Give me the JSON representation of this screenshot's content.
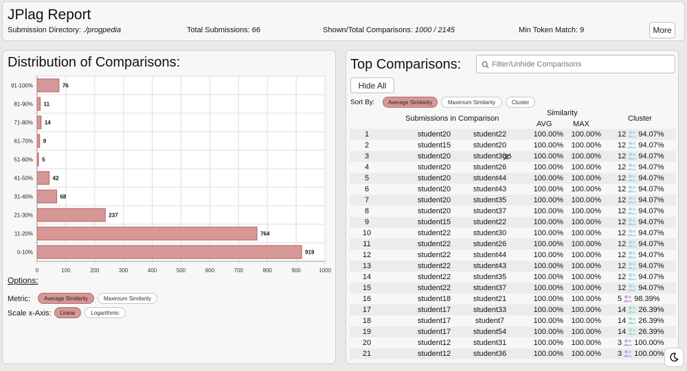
{
  "header": {
    "title": "JPlag Report",
    "dir_label": "Submission Directory:",
    "dir_value": "./progpedia",
    "total_label": "Total Submissions:",
    "total_value": "66",
    "shown_label": "Shown/Total Comparisons:",
    "shown_value": "1000 / 2145",
    "min_label": "Min Token Match:",
    "min_value": "9",
    "more_button": "More"
  },
  "distribution": {
    "title": "Distribution of Comparisons:",
    "options_title": "Options:",
    "metric_label": "Metric:",
    "metric_options": [
      "Average Similarity",
      "Maximum Similarity"
    ],
    "metric_selected": "Average Similarity",
    "scale_label": "Scale x-Axis:",
    "scale_options": [
      "Linear",
      "Logarithmic"
    ],
    "scale_selected": "Linear"
  },
  "chart_data": {
    "type": "bar",
    "orientation": "horizontal",
    "categories": [
      "91-100%",
      "81-90%",
      "71-80%",
      "61-70%",
      "51-60%",
      "41-50%",
      "31-40%",
      "21-30%",
      "11-20%",
      "0-10%"
    ],
    "values": [
      76,
      11,
      14,
      9,
      5,
      42,
      68,
      237,
      764,
      919
    ],
    "xlim": [
      0,
      1000
    ],
    "xticks": [
      0,
      100,
      200,
      300,
      400,
      500,
      600,
      700,
      800,
      900,
      1000
    ],
    "grid": true,
    "bar_color": "#d69797",
    "bar_border": "#b06666"
  },
  "top": {
    "title": "Top Comparisons:",
    "search_placeholder": "Filter/Unhide Comparisons",
    "hide_all": "Hide All",
    "sort_label": "Sort By:",
    "sort_options": [
      "Average Similarity",
      "Maximum Similarity",
      "Cluster"
    ],
    "sort_selected": "Average Similarity",
    "col_submissions": "Submissions in Comparison",
    "col_similarity": "Similarity",
    "col_avg": "AVG",
    "col_max": "MAX",
    "col_cluster": "Cluster",
    "rows": [
      {
        "n": "1",
        "a": "student20",
        "b": "student22",
        "avg": "100.00%",
        "max": "100.00%",
        "csize": "12",
        "cval": "94.07%",
        "ccolor": "#a8d8ea",
        "hidden": false
      },
      {
        "n": "2",
        "a": "student15",
        "b": "student20",
        "avg": "100.00%",
        "max": "100.00%",
        "csize": "12",
        "cval": "94.07%",
        "ccolor": "#a8d8ea",
        "hidden": false
      },
      {
        "n": "3",
        "a": "student20",
        "b": "student30",
        "avg": "100.00%",
        "max": "100.00%",
        "csize": "12",
        "cval": "94.07%",
        "ccolor": "#a8d8ea",
        "hidden": true
      },
      {
        "n": "4",
        "a": "student20",
        "b": "student26",
        "avg": "100.00%",
        "max": "100.00%",
        "csize": "12",
        "cval": "94.07%",
        "ccolor": "#a8d8ea",
        "hidden": false
      },
      {
        "n": "5",
        "a": "student20",
        "b": "student44",
        "avg": "100.00%",
        "max": "100.00%",
        "csize": "12",
        "cval": "94.07%",
        "ccolor": "#a8d8ea",
        "hidden": false
      },
      {
        "n": "6",
        "a": "student20",
        "b": "student43",
        "avg": "100.00%",
        "max": "100.00%",
        "csize": "12",
        "cval": "94.07%",
        "ccolor": "#a8d8ea",
        "hidden": false
      },
      {
        "n": "7",
        "a": "student20",
        "b": "student35",
        "avg": "100.00%",
        "max": "100.00%",
        "csize": "12",
        "cval": "94.07%",
        "ccolor": "#a8d8ea",
        "hidden": false
      },
      {
        "n": "8",
        "a": "student20",
        "b": "student37",
        "avg": "100.00%",
        "max": "100.00%",
        "csize": "12",
        "cval": "94.07%",
        "ccolor": "#a8d8ea",
        "hidden": false
      },
      {
        "n": "9",
        "a": "student15",
        "b": "student22",
        "avg": "100.00%",
        "max": "100.00%",
        "csize": "12",
        "cval": "94.07%",
        "ccolor": "#a8d8ea",
        "hidden": false
      },
      {
        "n": "10",
        "a": "student22",
        "b": "student30",
        "avg": "100.00%",
        "max": "100.00%",
        "csize": "12",
        "cval": "94.07%",
        "ccolor": "#a8d8ea",
        "hidden": false
      },
      {
        "n": "11",
        "a": "student22",
        "b": "student26",
        "avg": "100.00%",
        "max": "100.00%",
        "csize": "12",
        "cval": "94.07%",
        "ccolor": "#a8d8ea",
        "hidden": false
      },
      {
        "n": "12",
        "a": "student22",
        "b": "student44",
        "avg": "100.00%",
        "max": "100.00%",
        "csize": "12",
        "cval": "94.07%",
        "ccolor": "#a8d8ea",
        "hidden": false
      },
      {
        "n": "13",
        "a": "student22",
        "b": "student43",
        "avg": "100.00%",
        "max": "100.00%",
        "csize": "12",
        "cval": "94.07%",
        "ccolor": "#a8d8ea",
        "hidden": false
      },
      {
        "n": "14",
        "a": "student22",
        "b": "student35",
        "avg": "100.00%",
        "max": "100.00%",
        "csize": "12",
        "cval": "94.07%",
        "ccolor": "#a8d8ea",
        "hidden": false
      },
      {
        "n": "15",
        "a": "student22",
        "b": "student37",
        "avg": "100.00%",
        "max": "100.00%",
        "csize": "12",
        "cval": "94.07%",
        "ccolor": "#a8d8ea",
        "hidden": false
      },
      {
        "n": "16",
        "a": "student18",
        "b": "student21",
        "avg": "100.00%",
        "max": "100.00%",
        "csize": "5",
        "cval": "98.39%",
        "ccolor": "#c9a0dc",
        "hidden": false
      },
      {
        "n": "17",
        "a": "student17",
        "b": "student33",
        "avg": "100.00%",
        "max": "100.00%",
        "csize": "14",
        "cval": "26.39%",
        "ccolor": "#a8e0c0",
        "hidden": false
      },
      {
        "n": "18",
        "a": "student17",
        "b": "student7",
        "avg": "100.00%",
        "max": "100.00%",
        "csize": "14",
        "cval": "26.39%",
        "ccolor": "#a8e0c0",
        "hidden": false
      },
      {
        "n": "19",
        "a": "student17",
        "b": "student54",
        "avg": "100.00%",
        "max": "100.00%",
        "csize": "14",
        "cval": "26.39%",
        "ccolor": "#a8e0c0",
        "hidden": false
      },
      {
        "n": "20",
        "a": "student12",
        "b": "student31",
        "avg": "100.00%",
        "max": "100.00%",
        "csize": "3",
        "cval": "100.00%",
        "ccolor": "#b8b0e8",
        "hidden": false
      },
      {
        "n": "21",
        "a": "student12",
        "b": "student36",
        "avg": "100.00%",
        "max": "100.00%",
        "csize": "3",
        "cval": "100.00%",
        "ccolor": "#b8b0e8",
        "hidden": false
      }
    ]
  },
  "icons": {
    "search": "search-icon",
    "hidden": "eye-off-icon",
    "cluster": "people-icon",
    "theme": "moon-icon"
  }
}
